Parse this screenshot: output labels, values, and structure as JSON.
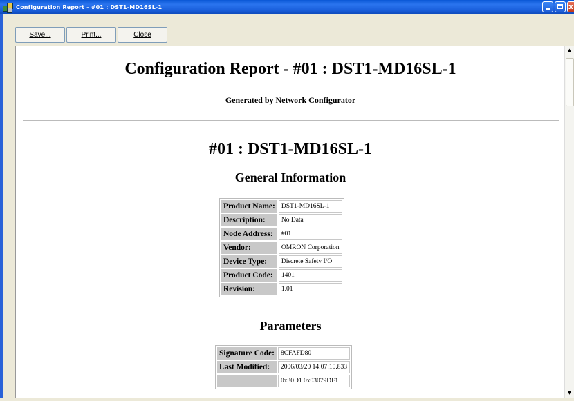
{
  "window": {
    "title": "Configuration Report - #01 : DST1-MD16SL-1",
    "close_glyph": "x"
  },
  "toolbar": {
    "save_label": "Save...",
    "print_label": "Print...",
    "close_label": "Close"
  },
  "report": {
    "title": "Configuration Report - #01 : DST1-MD16SL-1",
    "subtitle": "Generated by Network Configurator",
    "device_heading": "#01 : DST1-MD16SL-1",
    "general_info": {
      "heading": "General Information",
      "rows": [
        {
          "key": "Product Name:",
          "value": "DST1-MD16SL-1"
        },
        {
          "key": "Description:",
          "value": "No Data"
        },
        {
          "key": "Node Address:",
          "value": "#01"
        },
        {
          "key": "Vendor:",
          "value": "OMRON Corporation"
        },
        {
          "key": "Device Type:",
          "value": "Discrete Safety I/O"
        },
        {
          "key": "Product Code:",
          "value": "1401"
        },
        {
          "key": "Revision:",
          "value": "1.01"
        }
      ]
    },
    "parameters": {
      "heading": "Parameters",
      "rows": [
        {
          "key": "Signature Code:",
          "value": "8CFAFD80"
        },
        {
          "key": "Last Modified:",
          "value": "2006/03/20 14:07:10.833"
        },
        {
          "key": "",
          "value": "0x30D1 0x03079DF1"
        }
      ]
    }
  },
  "scrollbar": {
    "up_arrow": "▲",
    "down_arrow": "▼"
  }
}
